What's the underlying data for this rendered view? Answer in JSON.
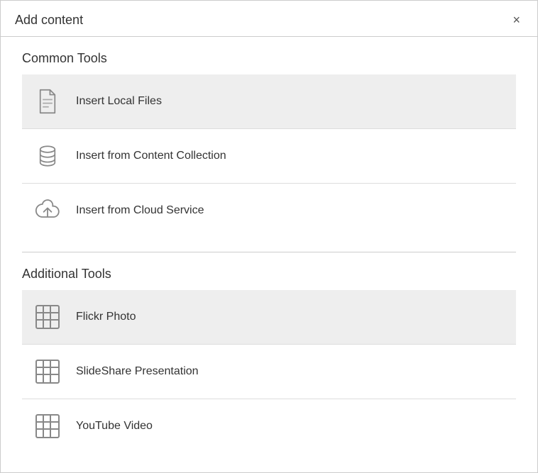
{
  "dialog": {
    "title": "Add content",
    "close_label": "×"
  },
  "common_tools": {
    "section_title": "Common Tools",
    "items": [
      {
        "id": "insert-local-files",
        "label": "Insert Local Files",
        "icon": "file"
      },
      {
        "id": "insert-content-collection",
        "label": "Insert from Content Collection",
        "icon": "database"
      },
      {
        "id": "insert-cloud-service",
        "label": "Insert from Cloud Service",
        "icon": "cloud"
      }
    ]
  },
  "additional_tools": {
    "section_title": "Additional Tools",
    "items": [
      {
        "id": "flickr-photo",
        "label": "Flickr Photo",
        "icon": "grid"
      },
      {
        "id": "slideshare-presentation",
        "label": "SlideShare Presentation",
        "icon": "grid"
      },
      {
        "id": "youtube-video",
        "label": "YouTube Video",
        "icon": "grid"
      }
    ]
  }
}
